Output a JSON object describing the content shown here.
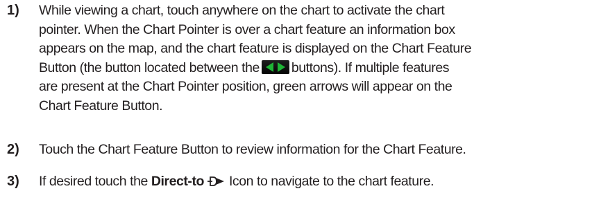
{
  "steps": [
    {
      "number": "1)",
      "lines": [
        "While viewing a chart, touch anywhere on the chart to activate the chart",
        "pointer.  When the Chart Pointer is over a chart feature an information box",
        "appears on the map, and the chart feature is displayed on the Chart Feature",
        "Button (the button located between the",
        "buttons).  If multiple features",
        "are present at the Chart Pointer position, green arrows will appear on the",
        "Chart Feature Button."
      ]
    },
    {
      "number": "2)",
      "text": "Touch the Chart Feature Button to review information for the Chart Feature."
    },
    {
      "number": "3)",
      "text_before": "If desired touch the",
      "bold": "Direct-to",
      "text_after": "Icon to navigate to the chart feature."
    }
  ],
  "icons": {
    "arrow_buttons": "left-right-green-arrow-buttons-icon",
    "direct_to": "direct-to-icon"
  },
  "colors": {
    "arrow_green": "#1fb436",
    "text": "#231f20"
  }
}
